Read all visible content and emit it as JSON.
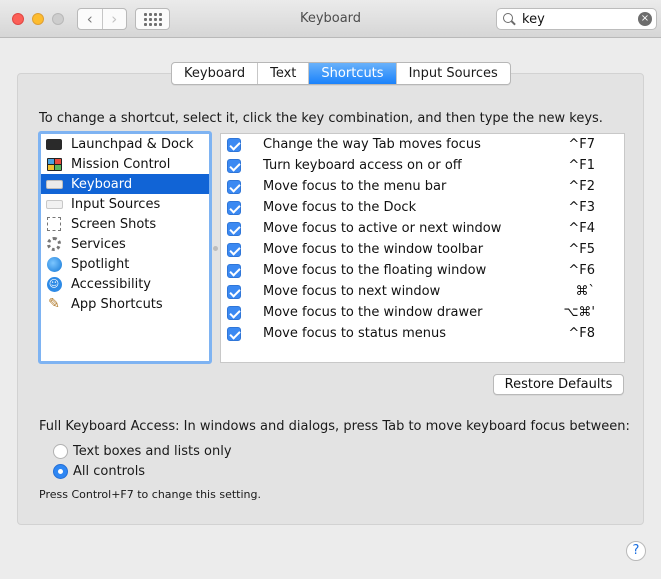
{
  "window": {
    "title": "Keyboard"
  },
  "toolbar": {
    "back_glyph": "‹",
    "forward_glyph": "›"
  },
  "search": {
    "value": "key",
    "clear_glyph": "×"
  },
  "tabs": [
    {
      "label": "Keyboard",
      "active": false
    },
    {
      "label": "Text",
      "active": false
    },
    {
      "label": "Shortcuts",
      "active": true
    },
    {
      "label": "Input Sources",
      "active": false
    }
  ],
  "instruction": "To change a shortcut, select it, click the key combination, and then type the new keys.",
  "categories": [
    {
      "label": "Launchpad & Dock",
      "icon": "launchpad-icon"
    },
    {
      "label": "Mission Control",
      "icon": "mission-control-icon"
    },
    {
      "label": "Keyboard",
      "icon": "keyboard-icon",
      "selected": true
    },
    {
      "label": "Input Sources",
      "icon": "input-sources-icon"
    },
    {
      "label": "Screen Shots",
      "icon": "screenshot-icon"
    },
    {
      "label": "Services",
      "icon": "services-gear-icon"
    },
    {
      "label": "Spotlight",
      "icon": "spotlight-icon"
    },
    {
      "label": "Accessibility",
      "icon": "accessibility-icon"
    },
    {
      "label": "App Shortcuts",
      "icon": "app-shortcuts-icon"
    }
  ],
  "shortcuts": [
    {
      "label": "Change the way Tab moves focus",
      "key": "^F7",
      "checked": true
    },
    {
      "label": "Turn keyboard access on or off",
      "key": "^F1",
      "checked": true
    },
    {
      "label": "Move focus to the menu bar",
      "key": "^F2",
      "checked": true
    },
    {
      "label": "Move focus to the Dock",
      "key": "^F3",
      "checked": true
    },
    {
      "label": "Move focus to active or next window",
      "key": "^F4",
      "checked": true
    },
    {
      "label": "Move focus to the window toolbar",
      "key": "^F5",
      "checked": true
    },
    {
      "label": "Move focus to the floating window",
      "key": "^F6",
      "checked": true
    },
    {
      "label": "Move focus to next window",
      "key": "⌘`",
      "checked": true
    },
    {
      "label": "Move focus to the window drawer",
      "key": "⌥⌘'",
      "checked": true
    },
    {
      "label": "Move focus to status menus",
      "key": "^F8",
      "checked": true
    }
  ],
  "restore_label": "Restore Defaults",
  "full_keyboard_access": {
    "label": "Full Keyboard Access: In windows and dialogs, press Tab to move keyboard focus between:",
    "options": [
      {
        "label": "Text boxes and lists only",
        "selected": false
      },
      {
        "label": "All controls",
        "selected": true
      }
    ],
    "hint": "Press Control+F7 to change this setting."
  },
  "help_glyph": "?",
  "colors": {
    "accent": "#1a82fb",
    "selection": "#1164d6",
    "checkbox": "#3b89f2"
  }
}
